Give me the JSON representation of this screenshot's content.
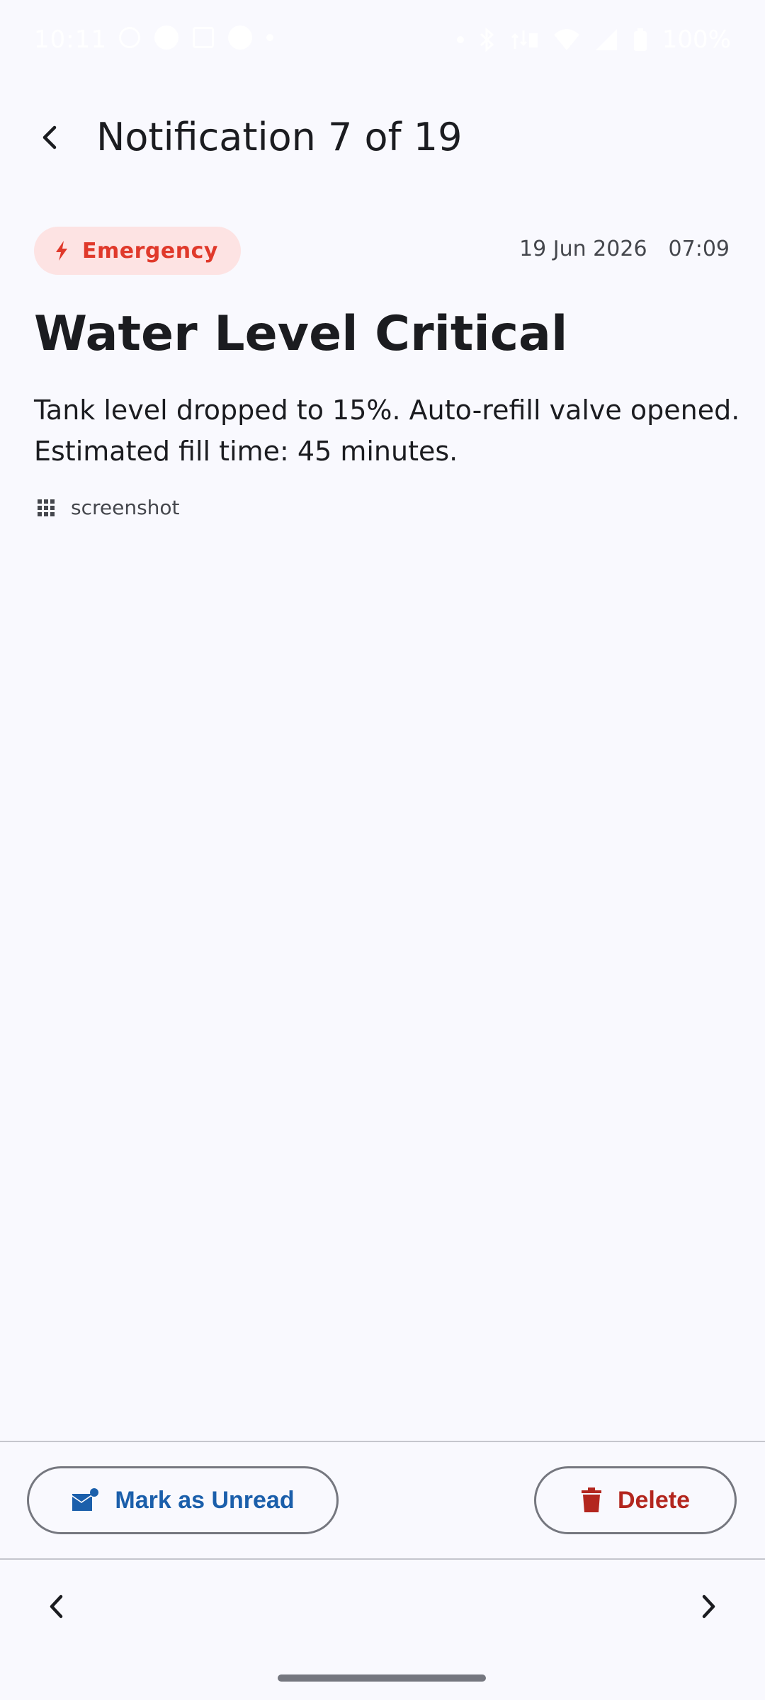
{
  "status_bar": {
    "time": "10:11",
    "battery": "100%"
  },
  "header": {
    "title": "Notification 7 of 19"
  },
  "notification": {
    "badge_label": "Emergency",
    "date": "19 Jun 2026",
    "time": "07:09",
    "title": "Water Level Critical",
    "body": "Tank level dropped to 15%. Auto-refill valve opened. Estimated fill time: 45 minutes.",
    "source": "screenshot"
  },
  "actions": {
    "mark_unread_label": "Mark as Unread",
    "delete_label": "Delete"
  },
  "colors": {
    "background": "#f9f9fe",
    "emergency_text": "#e0392b",
    "emergency_bg": "#fde3e3",
    "primary": "#1b5fab",
    "danger": "#b3261e"
  }
}
